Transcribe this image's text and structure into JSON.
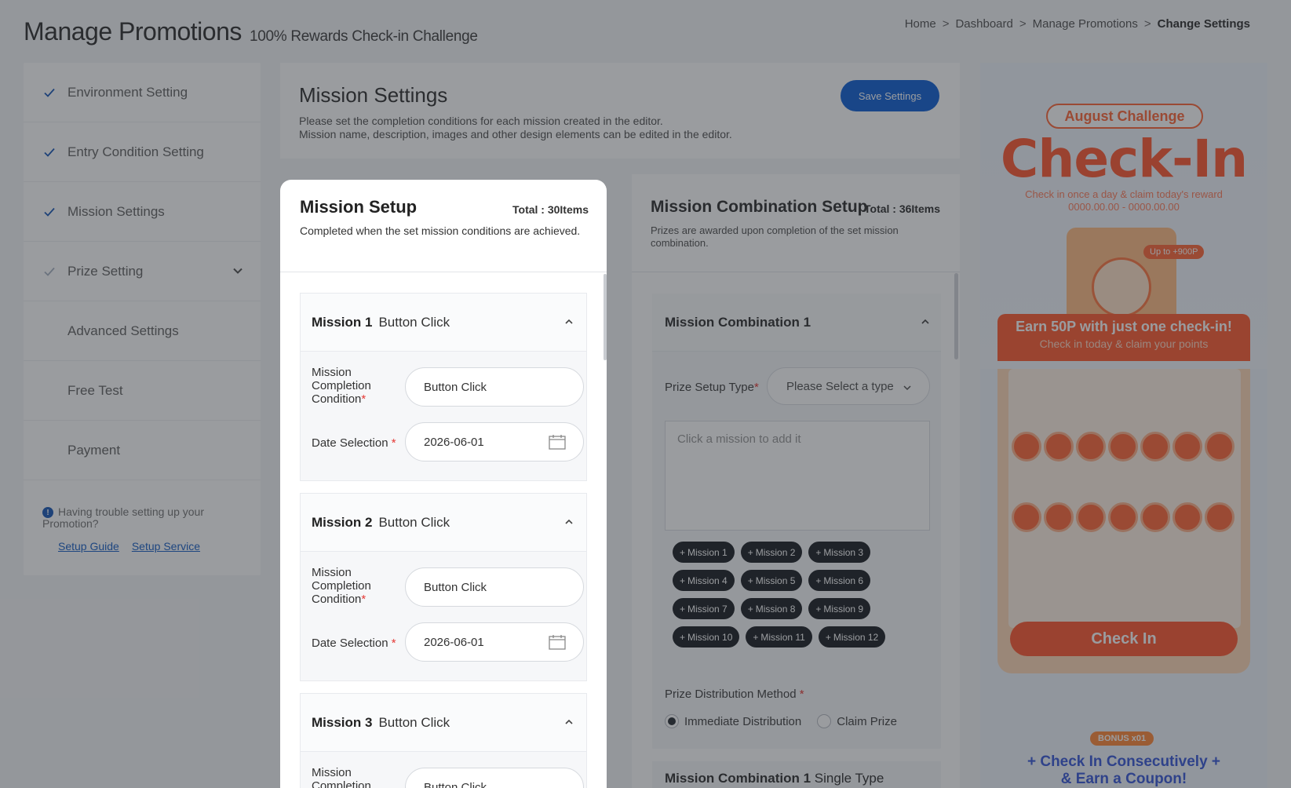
{
  "header": {
    "title": "Manage Promotions",
    "subtitle": "100% Rewards Check-in Challenge",
    "breadcrumb": [
      "Home",
      "Dashboard",
      "Manage Promotions",
      "Change Settings"
    ],
    "sep": ">"
  },
  "sidebar": {
    "items": [
      {
        "label": "Environment Setting",
        "checked": true
      },
      {
        "label": "Entry Condition Setting",
        "checked": true
      },
      {
        "label": "Mission Settings",
        "checked": true
      },
      {
        "label": "Prize Setting",
        "checked": true,
        "expandable": true
      },
      {
        "label": "Advanced Settings",
        "checked": false
      },
      {
        "label": "Free Test",
        "checked": false
      },
      {
        "label": "Payment",
        "checked": false
      }
    ],
    "help_text": "Having trouble setting up your Promotion?",
    "help_info": "!",
    "link_guide": "Setup Guide",
    "link_service": "Setup Service"
  },
  "mission_settings": {
    "title": "Mission Settings",
    "desc1": "Please set the completion conditions for each mission created in the editor.",
    "desc2": "Mission name, description, images and other design elements can be edited in the editor.",
    "save_label": "Save Settings"
  },
  "mission_setup": {
    "title": "Mission Setup",
    "total": "Total : 30Items",
    "desc": "Completed when the set mission conditions are achieved.",
    "condition_label": "Mission Completion Condition",
    "date_label": "Date Selection",
    "missions": [
      {
        "num": "Mission 1",
        "type": "Button Click",
        "condition": "Button Click",
        "date": "2026-06-01"
      },
      {
        "num": "Mission 2",
        "type": "Button Click",
        "condition": "Button Click",
        "date": "2026-06-01"
      },
      {
        "num": "Mission 3",
        "type": "Button Click",
        "condition": "Button Click",
        "date": ""
      }
    ]
  },
  "combination": {
    "title": "Mission Combination Setup",
    "total": "Total : 36Items",
    "desc": "Prizes are awarded upon completion of the set mission combination.",
    "block_title": "Mission Combination 1",
    "prize_type_label": "Prize Setup Type",
    "prize_type_placeholder": "Please Select a type",
    "drop_placeholder": "Click a mission to add it",
    "chips": [
      "Mission 1",
      "Mission 2",
      "Mission 3",
      "Mission 4",
      "Mission 5",
      "Mission 6",
      "Mission 7",
      "Mission 8",
      "Mission 9",
      "Mission 10",
      "Mission 11",
      "Mission 12"
    ],
    "chip_prefix": "+",
    "dist_label": "Prize Distribution Method",
    "dist_options": [
      "Immediate Distribution",
      "Claim Prize"
    ],
    "dist_selected": 0,
    "next_title": "Mission Combination 1",
    "next_type": "Single Type"
  },
  "preview": {
    "pill": "August Challenge",
    "headline": "Check-In",
    "line1": "Check in once a day & claim today's reward",
    "line2": "0000.00.00 - 0000.00.00",
    "upto": "Up to +900P",
    "earn": "Earn 50P with just one check-in!",
    "earn_sub": "Check in today & claim your points",
    "button": "Check In",
    "bonus": "BONUS x01",
    "cons1": "+ Check In Consecutively +",
    "cons2": "& Earn a Coupon!"
  },
  "colors": {
    "accent": "#1463d6",
    "brand_orange": "#ff5b36",
    "chip": "#1f2328",
    "required": "#e53935"
  }
}
